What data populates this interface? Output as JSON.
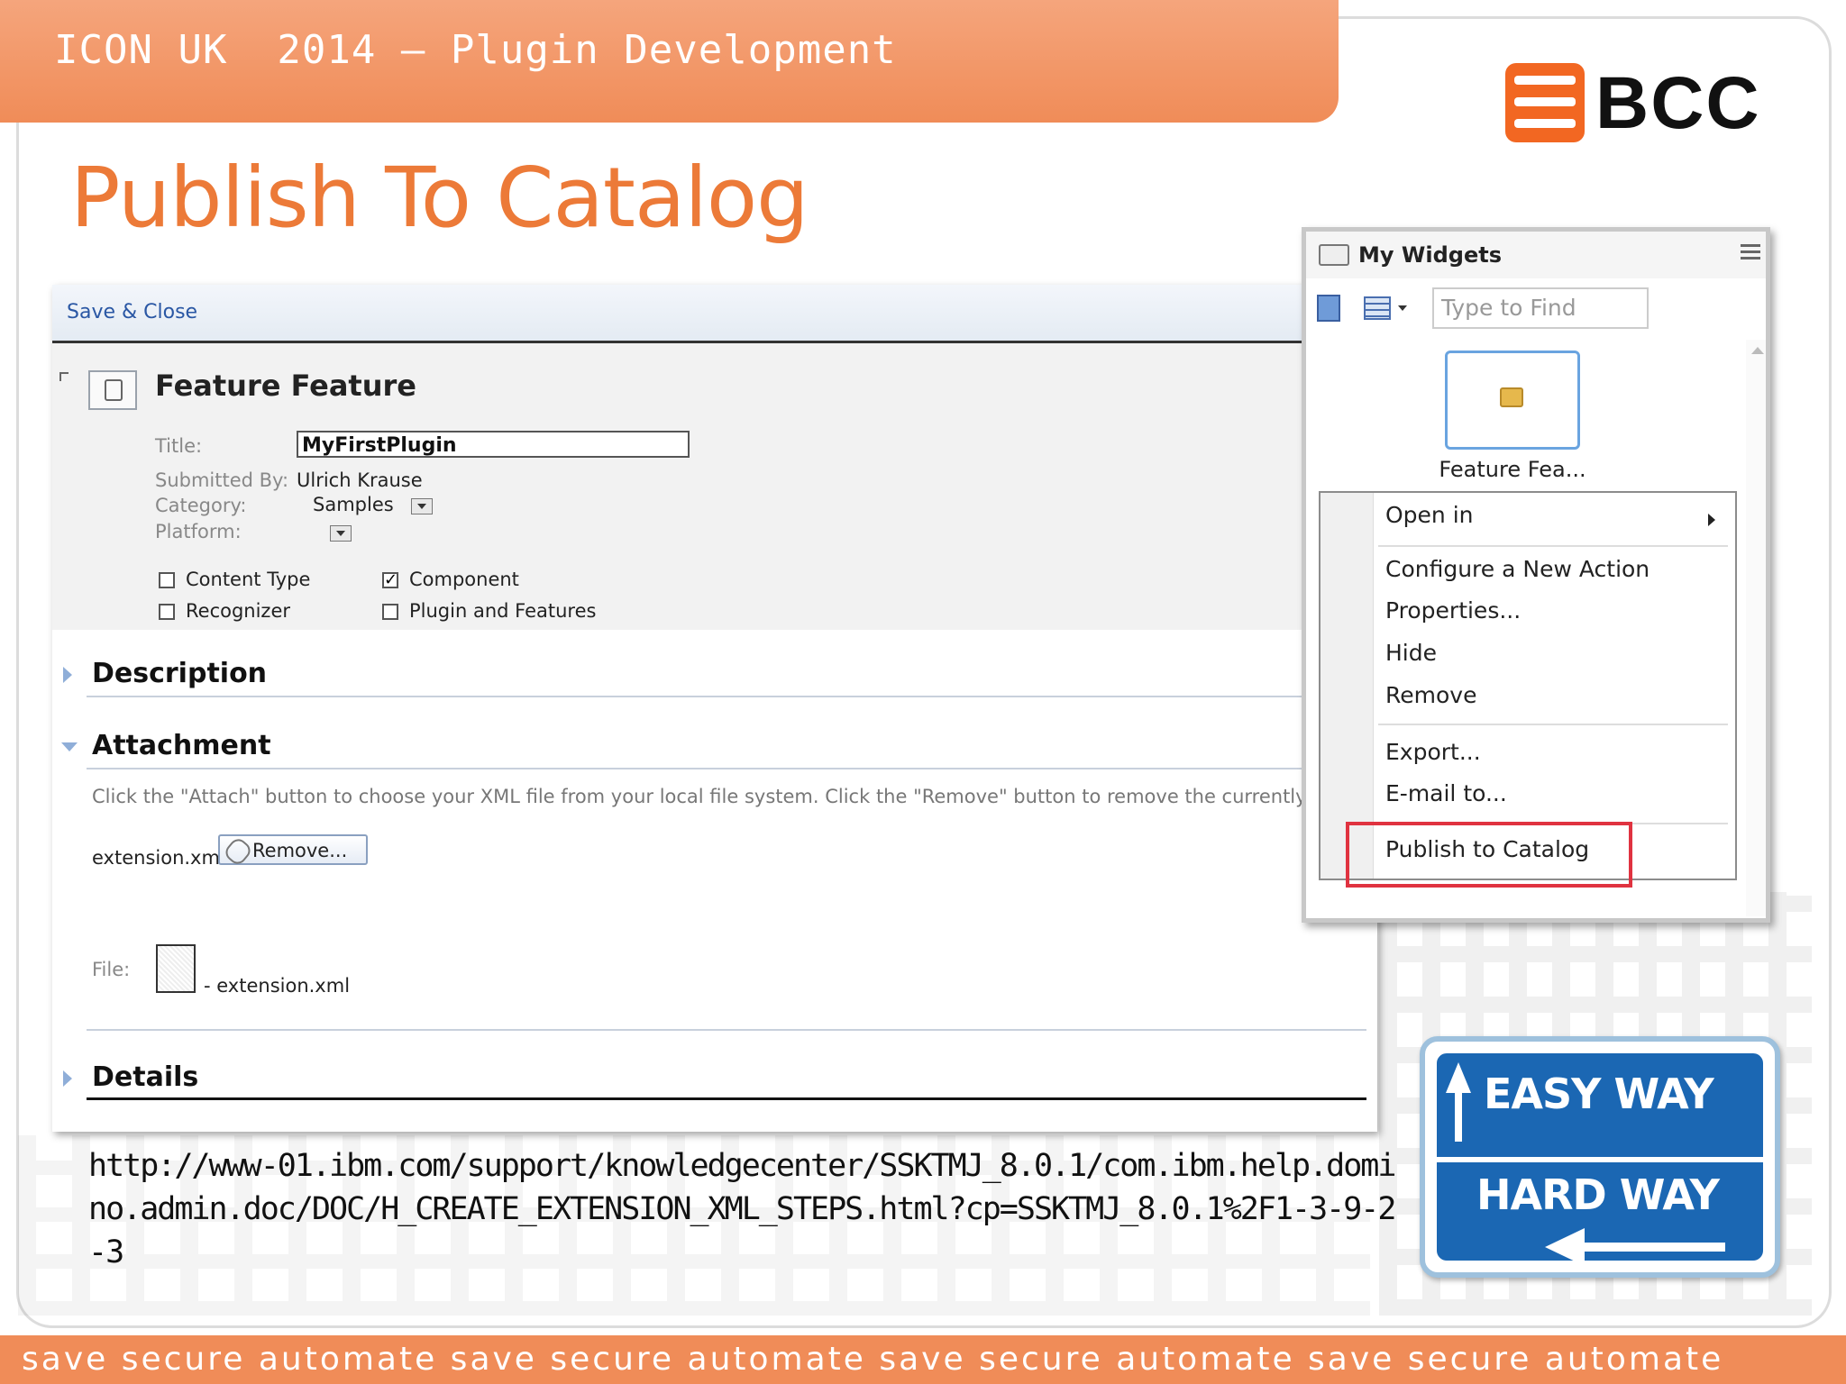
{
  "header": {
    "title": "ICON UK  2014 – Plugin Development"
  },
  "logo": {
    "text": "BCC",
    "accent": "#f26722"
  },
  "slide": {
    "title": "Publish To Catalog"
  },
  "form": {
    "toolbar": {
      "save_close": "Save & Close"
    },
    "heading": "Feature Feature",
    "fields": {
      "title_label": "Title:",
      "title_value": "MyFirstPlugin",
      "submitted_label": "Submitted By:",
      "submitted_value": "Ulrich Krause",
      "category_label": "Category:",
      "category_value": "Samples",
      "platform_label": "Platform:"
    },
    "checkboxes": [
      {
        "label": "Content Type",
        "checked": false
      },
      {
        "label": "Component",
        "checked": true
      },
      {
        "label": "Recognizer",
        "checked": false
      },
      {
        "label": "Plugin and Features",
        "checked": false
      }
    ],
    "sections": {
      "description": "Description",
      "attachment": "Attachment",
      "details": "Details"
    },
    "attachment": {
      "help": "Click the \"Attach\" button to choose your XML file from your local file system.  Click the \"Remove\" button to remove the currently attached",
      "filename": "extension.xml",
      "remove_button": "Remove...",
      "file_label": "File:",
      "file_name": "- extension.xml"
    }
  },
  "widgets": {
    "title": "My Widgets",
    "search_placeholder": "Type to Find",
    "tile_label": "Feature Fea...",
    "context_menu": {
      "open_in": "Open in",
      "configure": "Configure a New Action",
      "properties": "Properties...",
      "hide": "Hide",
      "remove": "Remove",
      "export": "Export...",
      "email": "E-mail to...",
      "publish": "Publish to Catalog"
    },
    "highlight_color": "#e03340"
  },
  "url": {
    "text": "http://www-01.ibm.com/support/knowledgecenter/SSKTMJ_8.0.1/com.ibm.help.domino.admin.doc/DOC/H_CREATE_EXTENSION_XML_STEPS.html?cp=SSKTMJ_8.0.1%2F1-3-9-2-3"
  },
  "sign": {
    "easy": "EASY WAY",
    "hard": "HARD WAY",
    "color": "#1b67b3"
  },
  "footer": {
    "text": "save secure automate save secure automate save secure automate save secure automate",
    "color": "#f08c58"
  },
  "theme": {
    "accent": "#ec7a38"
  }
}
